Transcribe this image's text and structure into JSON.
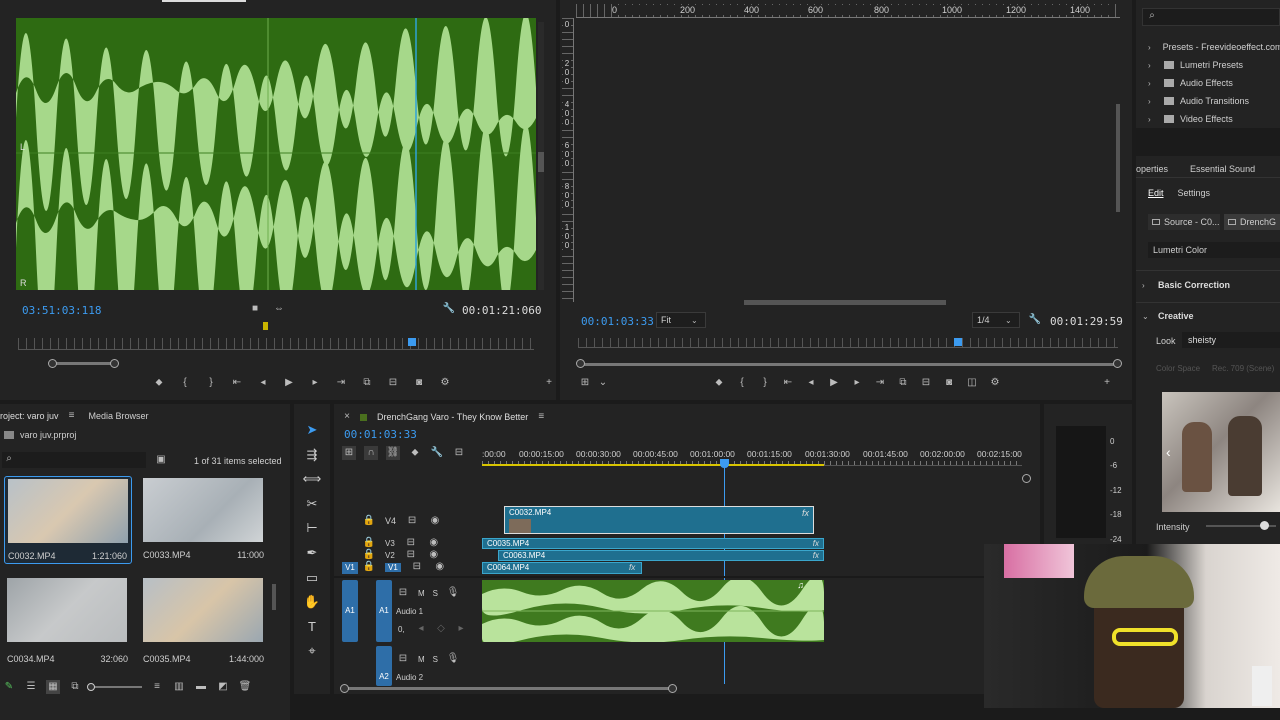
{
  "source_monitor": {
    "channel_l": "L",
    "channel_r": "R",
    "channel_l2": "L",
    "channel_r2": "R",
    "timecode": "03:51:03:118",
    "duration": "00:01:21:060"
  },
  "program_monitor": {
    "ruler_ticks": [
      "0",
      "200",
      "400",
      "600",
      "800",
      "1000",
      "1200",
      "1400"
    ],
    "vruler_ticks": [
      "0",
      "2",
      "0",
      "0",
      "4",
      "0",
      "0",
      "6",
      "0",
      "0",
      "8",
      "0",
      "0",
      "1",
      "0",
      "0",
      "1",
      "0"
    ],
    "timecode": "00:01:03:33",
    "zoom": "Fit",
    "resolution": "1/4",
    "duration": "00:01:29:59"
  },
  "effects_panel": {
    "items": [
      "Presets - Freevideoeffect.com",
      "Lumetri Presets",
      "Audio Effects",
      "Audio Transitions",
      "Video Effects"
    ]
  },
  "lumetri": {
    "tabs": [
      "operties",
      "Essential Sound"
    ],
    "subtabs": [
      "Edit",
      "Settings"
    ],
    "source_label": "Source - C0...",
    "seq_label": "DrenchG",
    "panel_title": "Lumetri Color",
    "basic": "Basic Correction",
    "creative": "Creative",
    "look_label": "Look",
    "look_value": "sheisty",
    "colorspace_label": "Color Space",
    "colorspace_value": "Rec. 709 (Scene)",
    "intensity_label": "Intensity"
  },
  "project": {
    "title": "roject: varo juv",
    "media_browser": "Media Browser",
    "file": "varo juv.prproj",
    "selection": "1 of 31 items selected",
    "items": [
      {
        "name": "C0032.MP4",
        "dur": "1:21:060"
      },
      {
        "name": "C0033.MP4",
        "dur": "11:000"
      },
      {
        "name": "C0034.MP4",
        "dur": "32:060"
      },
      {
        "name": "C0035.MP4",
        "dur": "1:44:000"
      }
    ]
  },
  "timeline": {
    "title": "DrenchGang Varo - They Know Better",
    "timecode": "00:01:03:33",
    "ticks": [
      ":00:00",
      "00:00:15:00",
      "00:00:30:00",
      "00:00:45:00",
      "00:01:00:00",
      "00:01:15:00",
      "00:01:30:00",
      "00:01:45:00",
      "00:02:00:00",
      "00:02:15:00"
    ],
    "tracks": {
      "v4": "V4",
      "v3": "V3",
      "v2": "V2",
      "v1": "V1",
      "a1": "A1",
      "a2": "A2",
      "v1src": "V1",
      "a1src": "A1"
    },
    "clips": {
      "c1": "C0032.MP4",
      "c2": "C0035.MP4",
      "c3": "C0063.MP4",
      "c4": "C0064.MP4"
    },
    "audio1": "Audio 1",
    "audio2": "Audio 2",
    "m": "M",
    "s": "S",
    "fx": "fx",
    "level": "0,"
  },
  "meter": {
    "marks": [
      "0",
      "-6",
      "-12",
      "-18",
      "-24"
    ]
  }
}
